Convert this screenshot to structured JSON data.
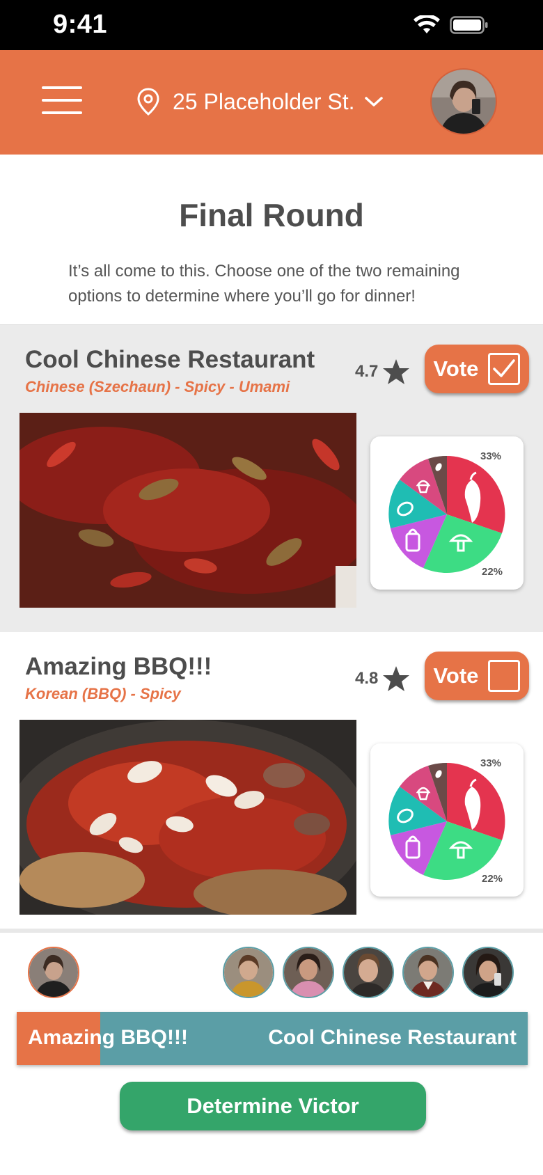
{
  "status_bar": {
    "time": "9:41"
  },
  "header": {
    "location": "25 Placeholder St.",
    "icons": [
      "menu-icon",
      "location-pin-icon",
      "chevron-down-icon"
    ]
  },
  "intro": {
    "title": "Final Round",
    "subtitle": "It’s all come to this. Choose one of the two remaining options to determine where you’ll go for dinner!"
  },
  "restaurants": [
    {
      "name": "Cool Chinese Restaurant",
      "tags": "Chinese (Szechaun) - Spicy - Umami",
      "rating": "4.7",
      "vote_label": "Vote",
      "voted": true,
      "pie": {
        "top_percent": "33%",
        "bottom_percent": "22%"
      }
    },
    {
      "name": "Amazing BBQ!!!",
      "tags": "Korean (BBQ) - Spicy",
      "rating": "4.8",
      "vote_label": "Vote",
      "voted": false,
      "pie": {
        "top_percent": "33%",
        "bottom_percent": "22%"
      }
    }
  ],
  "results": {
    "left_label": "Amazing BBQ!!!",
    "right_label": "Cool Chinese Restaurant",
    "left_voters": 1,
    "right_voters": 5
  },
  "actions": {
    "determine_label": "Determine Victor"
  },
  "colors": {
    "brand": "#e67347",
    "teal": "#5b9ea6",
    "green": "#34a56a",
    "pie_spicy": "#e4344f",
    "pie_umami": "#3ddc84",
    "pie_salty": "#c758e0",
    "pie_sour": "#1fbdb3",
    "pie_sweet": "#d8497f",
    "pie_bitter": "#6b4a48"
  }
}
